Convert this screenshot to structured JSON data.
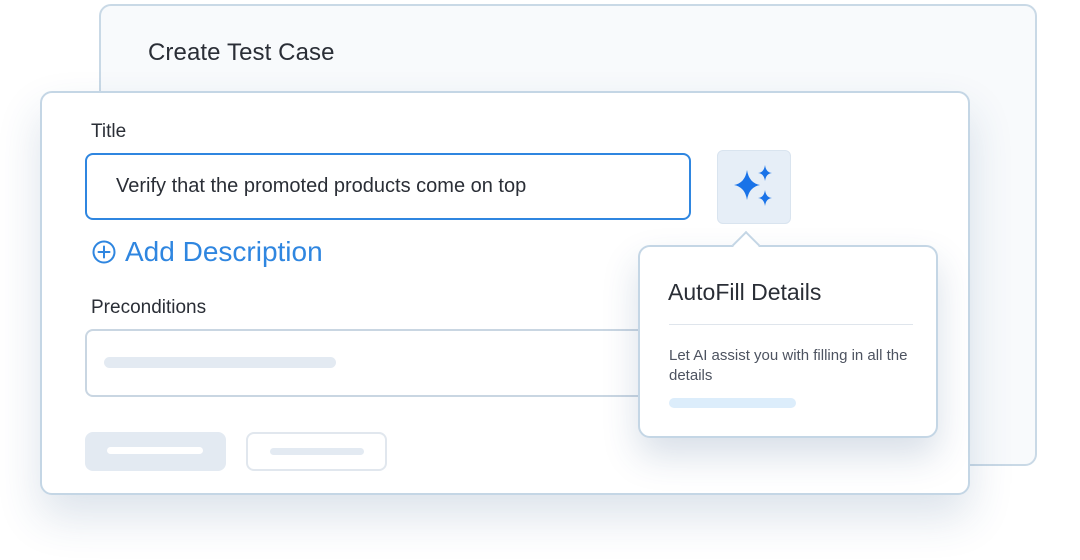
{
  "dialog": {
    "title": "Create Test Case"
  },
  "form": {
    "title_label": "Title",
    "title_value": "Verify that the promoted products come on top",
    "add_description_label": "Add Description",
    "preconditions_label": "Preconditions"
  },
  "popover": {
    "title": "AutoFill Details",
    "description": "Let AI assist you with filling in all the details"
  },
  "icons": {
    "ai_button": "sparkles-icon",
    "add_description": "plus-circle-icon"
  },
  "colors": {
    "accent": "#2f86e0",
    "sparkle": "#1a73e8",
    "card_border": "#c4d6e5",
    "skeleton": "#e3eaf2",
    "popover_skeleton": "#dcedfb"
  }
}
